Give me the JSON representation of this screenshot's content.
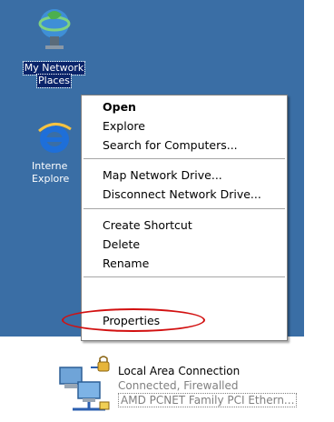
{
  "desktop": {
    "icons": [
      {
        "label_1": "My Network",
        "label_2": "Places",
        "icon": "network-places-icon"
      },
      {
        "label_1": "Interne",
        "label_2": "Explore",
        "icon": "internet-explorer-icon"
      }
    ]
  },
  "context_menu": {
    "items": [
      {
        "label": "Open",
        "default": true
      },
      {
        "label": "Explore"
      },
      {
        "label": "Search for Computers..."
      },
      {
        "label": "Map Network Drive..."
      },
      {
        "label": "Disconnect Network Drive..."
      },
      {
        "label": "Create Shortcut"
      },
      {
        "label": "Delete"
      },
      {
        "label": "Rename"
      },
      {
        "label": "Properties",
        "highlighted": true
      }
    ]
  },
  "connection": {
    "name": "Local Area Connection",
    "status": "Connected, Firewalled",
    "adapter": "AMD PCNET Family PCI Ethern...",
    "icon": "network-connection-locked-icon"
  },
  "colors": {
    "desktop": "#3a6ea5",
    "selection": "#0a246a",
    "annotation": "#d21010"
  }
}
